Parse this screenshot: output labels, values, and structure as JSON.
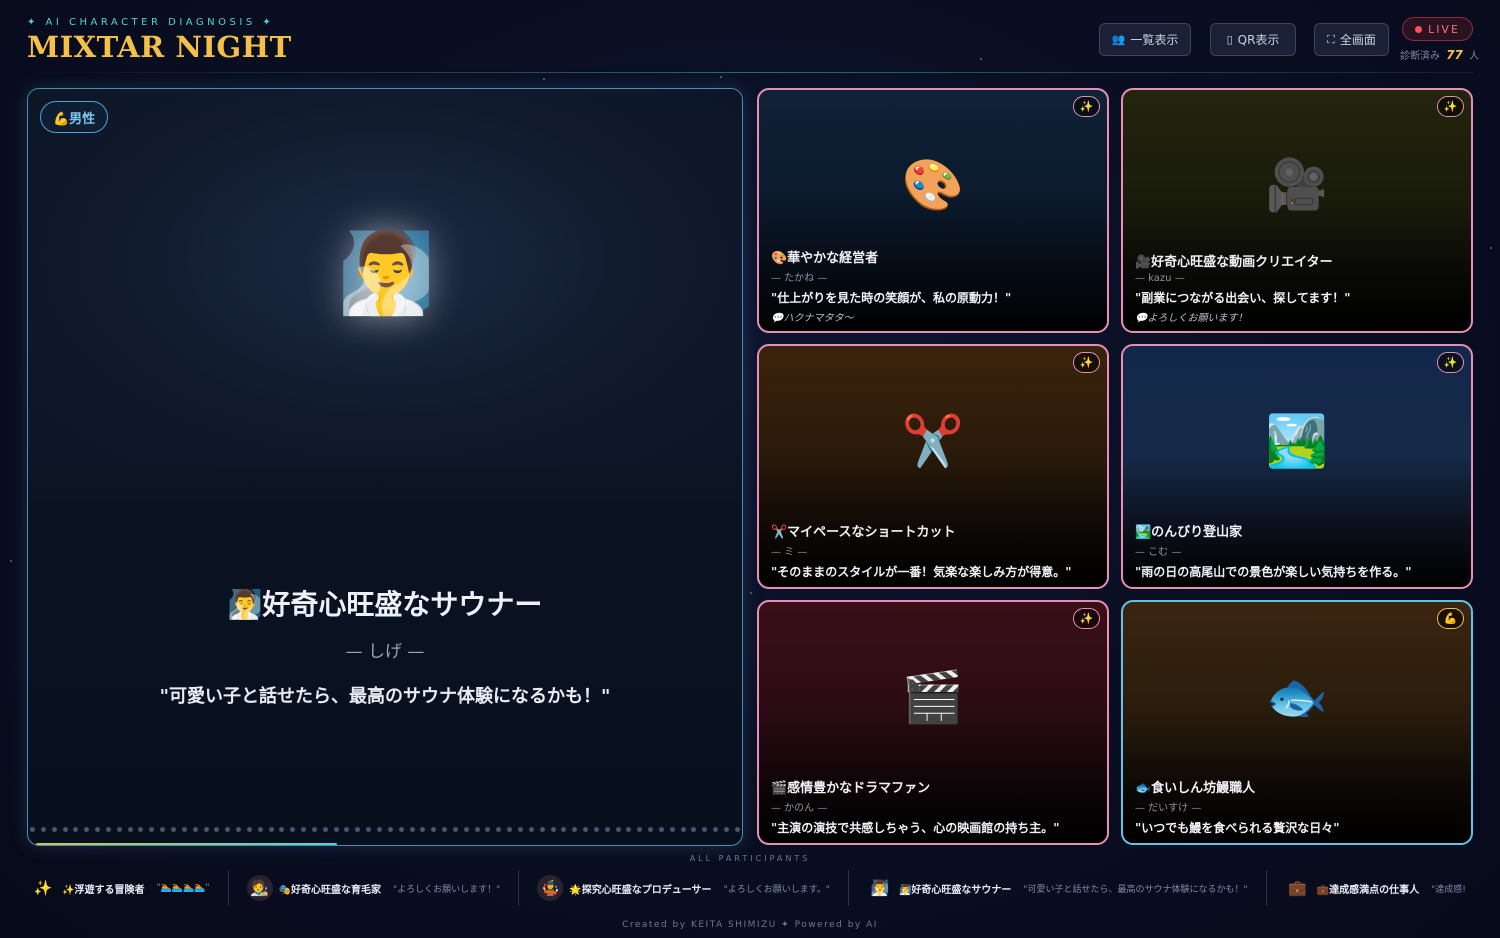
{
  "header": {
    "subtitle": "✦ AI CHARACTER DIAGNOSIS ✦",
    "title": "MIXTAR NIGHT",
    "buttons": [
      {
        "icon": "👥",
        "label": "一覧表示"
      },
      {
        "icon": "▯",
        "label": "QR表示"
      },
      {
        "icon": "⛶",
        "label": "全画面"
      }
    ],
    "live_label": "LIVE",
    "count_prefix": "診断済み",
    "count": "77",
    "count_suffix": "人"
  },
  "featured": {
    "badge": "💪男性",
    "emoji": "🧖‍♂️",
    "title": "🧖‍♂️好奇心旺盛なサウナー",
    "name": "— しげ —",
    "quote": "\"可愛い子と話せたら、最高のサウナ体験になるかも！\"",
    "progress": 0.43
  },
  "cards": [
    {
      "emoji": "🎨",
      "badge": "✨",
      "title": "🎨華やかな経営者",
      "name": "— たかね —",
      "quote": "\"仕上がりを見た時の笑顔が、私の原動力！\"",
      "comment": "💬ハクナマタタ〜",
      "bg": "linear-gradient(180deg,#0f2238 0%,#0b1a2c 45%,#050a12 78%,#000000 100%)",
      "accent": "pink"
    },
    {
      "emoji": "🎥",
      "badge": "✨",
      "title": "🎥好奇心旺盛な動画クリエイター",
      "name": "— kazu —",
      "quote": "\"副業につながる出会い、探してます！\"",
      "comment": "💬よろしくお願います！",
      "bg": "linear-gradient(180deg,#22240d 0%,#1a1c0b 45%,#080805 78%,#000000 100%)",
      "accent": "pink"
    },
    {
      "emoji": "✂️",
      "badge": "✨",
      "title": "✂️マイペースなショートカット",
      "name": "— ミ —",
      "quote": "\"そのままのスタイルが一番！気楽な楽しみ方が得意。\"",
      "comment": "",
      "bg": "linear-gradient(180deg,#3a230c 0%,#2a1a0a 45%,#0c0804 78%,#000000 100%)",
      "accent": "pink"
    },
    {
      "emoji": "🏞️",
      "badge": "✨",
      "title": "🏞️のんびり登山家",
      "name": "— こむ —",
      "quote": "\"雨の日の高尾山での景色が楽しい気持ちを作る。\"",
      "comment": "",
      "bg": "linear-gradient(180deg,#12284a 0%,#152a48 45%,#0a0e18 78%,#000000 100%)",
      "accent": "pink"
    },
    {
      "emoji": "🎬",
      "badge": "✨",
      "title": "🎬感情豊かなドラマファン",
      "name": "— かのん —",
      "quote": "\"主演の演技で共感しちゃう、心の映画館の持ち主。\"",
      "comment": "",
      "bg": "linear-gradient(180deg,#3a0f18 0%,#2c0c14 45%,#0c0406 78%,#000000 100%)",
      "accent": "pink"
    },
    {
      "emoji": "🐟",
      "badge": "💪",
      "title": "🐟食いしん坊鰻職人",
      "name": "— だいすけ —",
      "quote": "\"いつでも鰻を食べられる贅沢な日々\"",
      "comment": "",
      "bg": "linear-gradient(180deg,#3a2510 0%,#2a1c0c 45%,#0c0804 78%,#000000 100%)",
      "accent": "cyan"
    }
  ],
  "participants": {
    "label": "ALL PARTICIPANTS",
    "items": [
      {
        "avatar": "✨",
        "title": "✨浮遊する冒険者",
        "quote": "\"🏊🏊🏊🏊\""
      },
      {
        "avatar": "🧑‍🎨",
        "title": "🎭好奇心旺盛な育毛家",
        "quote": "\"よろしくお願いします！\""
      },
      {
        "avatar": "🤹",
        "title": "🌟探究心旺盛なプロデューサー",
        "quote": "\"よろしくお願いします。\""
      },
      {
        "avatar": "🧖‍♂️",
        "title": "🧖‍♂️好奇心旺盛なサウナー",
        "quote": "\"可愛い子と話せたら、最高のサウナ体験になるかも！\""
      },
      {
        "avatar": "💼",
        "title": "💼達成感満点の仕事人",
        "quote": "\"達成感!"
      }
    ]
  },
  "footer": "Created by KEITA SHIMIZU ✦ Powered by AI"
}
